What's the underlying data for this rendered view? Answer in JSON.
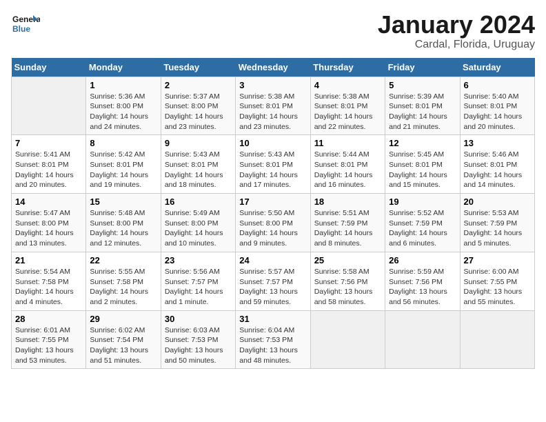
{
  "logo": {
    "line1": "General",
    "line2": "Blue"
  },
  "title": "January 2024",
  "subtitle": "Cardal, Florida, Uruguay",
  "days_header": [
    "Sunday",
    "Monday",
    "Tuesday",
    "Wednesday",
    "Thursday",
    "Friday",
    "Saturday"
  ],
  "weeks": [
    [
      {
        "num": "",
        "info": ""
      },
      {
        "num": "1",
        "info": "Sunrise: 5:36 AM\nSunset: 8:00 PM\nDaylight: 14 hours\nand 24 minutes."
      },
      {
        "num": "2",
        "info": "Sunrise: 5:37 AM\nSunset: 8:00 PM\nDaylight: 14 hours\nand 23 minutes."
      },
      {
        "num": "3",
        "info": "Sunrise: 5:38 AM\nSunset: 8:01 PM\nDaylight: 14 hours\nand 23 minutes."
      },
      {
        "num": "4",
        "info": "Sunrise: 5:38 AM\nSunset: 8:01 PM\nDaylight: 14 hours\nand 22 minutes."
      },
      {
        "num": "5",
        "info": "Sunrise: 5:39 AM\nSunset: 8:01 PM\nDaylight: 14 hours\nand 21 minutes."
      },
      {
        "num": "6",
        "info": "Sunrise: 5:40 AM\nSunset: 8:01 PM\nDaylight: 14 hours\nand 20 minutes."
      }
    ],
    [
      {
        "num": "7",
        "info": "Sunrise: 5:41 AM\nSunset: 8:01 PM\nDaylight: 14 hours\nand 20 minutes."
      },
      {
        "num": "8",
        "info": "Sunrise: 5:42 AM\nSunset: 8:01 PM\nDaylight: 14 hours\nand 19 minutes."
      },
      {
        "num": "9",
        "info": "Sunrise: 5:43 AM\nSunset: 8:01 PM\nDaylight: 14 hours\nand 18 minutes."
      },
      {
        "num": "10",
        "info": "Sunrise: 5:43 AM\nSunset: 8:01 PM\nDaylight: 14 hours\nand 17 minutes."
      },
      {
        "num": "11",
        "info": "Sunrise: 5:44 AM\nSunset: 8:01 PM\nDaylight: 14 hours\nand 16 minutes."
      },
      {
        "num": "12",
        "info": "Sunrise: 5:45 AM\nSunset: 8:01 PM\nDaylight: 14 hours\nand 15 minutes."
      },
      {
        "num": "13",
        "info": "Sunrise: 5:46 AM\nSunset: 8:01 PM\nDaylight: 14 hours\nand 14 minutes."
      }
    ],
    [
      {
        "num": "14",
        "info": "Sunrise: 5:47 AM\nSunset: 8:00 PM\nDaylight: 14 hours\nand 13 minutes."
      },
      {
        "num": "15",
        "info": "Sunrise: 5:48 AM\nSunset: 8:00 PM\nDaylight: 14 hours\nand 12 minutes."
      },
      {
        "num": "16",
        "info": "Sunrise: 5:49 AM\nSunset: 8:00 PM\nDaylight: 14 hours\nand 10 minutes."
      },
      {
        "num": "17",
        "info": "Sunrise: 5:50 AM\nSunset: 8:00 PM\nDaylight: 14 hours\nand 9 minutes."
      },
      {
        "num": "18",
        "info": "Sunrise: 5:51 AM\nSunset: 7:59 PM\nDaylight: 14 hours\nand 8 minutes."
      },
      {
        "num": "19",
        "info": "Sunrise: 5:52 AM\nSunset: 7:59 PM\nDaylight: 14 hours\nand 6 minutes."
      },
      {
        "num": "20",
        "info": "Sunrise: 5:53 AM\nSunset: 7:59 PM\nDaylight: 14 hours\nand 5 minutes."
      }
    ],
    [
      {
        "num": "21",
        "info": "Sunrise: 5:54 AM\nSunset: 7:58 PM\nDaylight: 14 hours\nand 4 minutes."
      },
      {
        "num": "22",
        "info": "Sunrise: 5:55 AM\nSunset: 7:58 PM\nDaylight: 14 hours\nand 2 minutes."
      },
      {
        "num": "23",
        "info": "Sunrise: 5:56 AM\nSunset: 7:57 PM\nDaylight: 14 hours\nand 1 minute."
      },
      {
        "num": "24",
        "info": "Sunrise: 5:57 AM\nSunset: 7:57 PM\nDaylight: 13 hours\nand 59 minutes."
      },
      {
        "num": "25",
        "info": "Sunrise: 5:58 AM\nSunset: 7:56 PM\nDaylight: 13 hours\nand 58 minutes."
      },
      {
        "num": "26",
        "info": "Sunrise: 5:59 AM\nSunset: 7:56 PM\nDaylight: 13 hours\nand 56 minutes."
      },
      {
        "num": "27",
        "info": "Sunrise: 6:00 AM\nSunset: 7:55 PM\nDaylight: 13 hours\nand 55 minutes."
      }
    ],
    [
      {
        "num": "28",
        "info": "Sunrise: 6:01 AM\nSunset: 7:55 PM\nDaylight: 13 hours\nand 53 minutes."
      },
      {
        "num": "29",
        "info": "Sunrise: 6:02 AM\nSunset: 7:54 PM\nDaylight: 13 hours\nand 51 minutes."
      },
      {
        "num": "30",
        "info": "Sunrise: 6:03 AM\nSunset: 7:53 PM\nDaylight: 13 hours\nand 50 minutes."
      },
      {
        "num": "31",
        "info": "Sunrise: 6:04 AM\nSunset: 7:53 PM\nDaylight: 13 hours\nand 48 minutes."
      },
      {
        "num": "",
        "info": ""
      },
      {
        "num": "",
        "info": ""
      },
      {
        "num": "",
        "info": ""
      }
    ]
  ]
}
